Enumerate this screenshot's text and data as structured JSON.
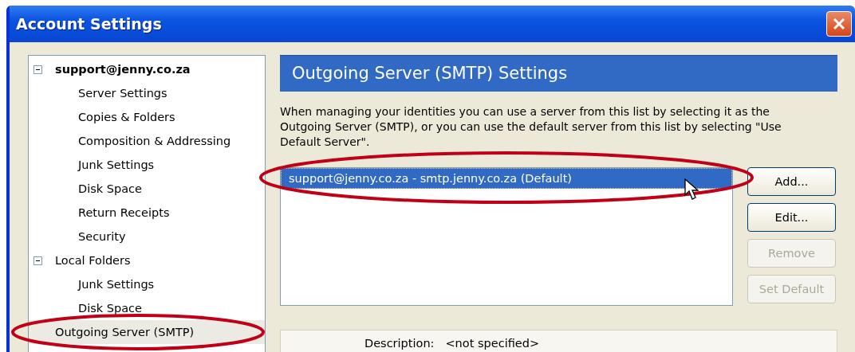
{
  "window": {
    "title": "Account Settings"
  },
  "tree": [
    {
      "label": "support@jenny.co.za",
      "kind": "account",
      "expanded": true,
      "selected": false,
      "children": [
        {
          "label": "Server Settings",
          "selected": false
        },
        {
          "label": "Copies & Folders",
          "selected": false
        },
        {
          "label": "Composition & Addressing",
          "selected": false
        },
        {
          "label": "Junk Settings",
          "selected": false
        },
        {
          "label": "Disk Space",
          "selected": false
        },
        {
          "label": "Return Receipts",
          "selected": false
        },
        {
          "label": "Security",
          "selected": false
        }
      ]
    },
    {
      "label": "Local Folders",
      "kind": "folder",
      "expanded": true,
      "selected": false,
      "children": [
        {
          "label": "Junk Settings",
          "selected": false
        },
        {
          "label": "Disk Space",
          "selected": false
        }
      ]
    },
    {
      "label": "Outgoing Server (SMTP)",
      "kind": "folder",
      "selected": true
    }
  ],
  "panel": {
    "heading": "Outgoing Server (SMTP) Settings",
    "description": "When managing your identities you can use a server from this list by selecting it as the Outgoing Server (SMTP), or you can use the default server from this list by selecting \"Use Default Server\".",
    "servers": [
      {
        "label": "support@jenny.co.za - smtp.jenny.co.za (Default)",
        "selected": true
      }
    ],
    "buttons": [
      {
        "label": "Add...",
        "disabled": false
      },
      {
        "label": "Edit...",
        "disabled": false
      },
      {
        "label": "Remove",
        "disabled": true
      },
      {
        "label": "Set Default",
        "disabled": true
      }
    ],
    "details": [
      {
        "label": "Description:",
        "value": "<not specified>"
      }
    ]
  }
}
